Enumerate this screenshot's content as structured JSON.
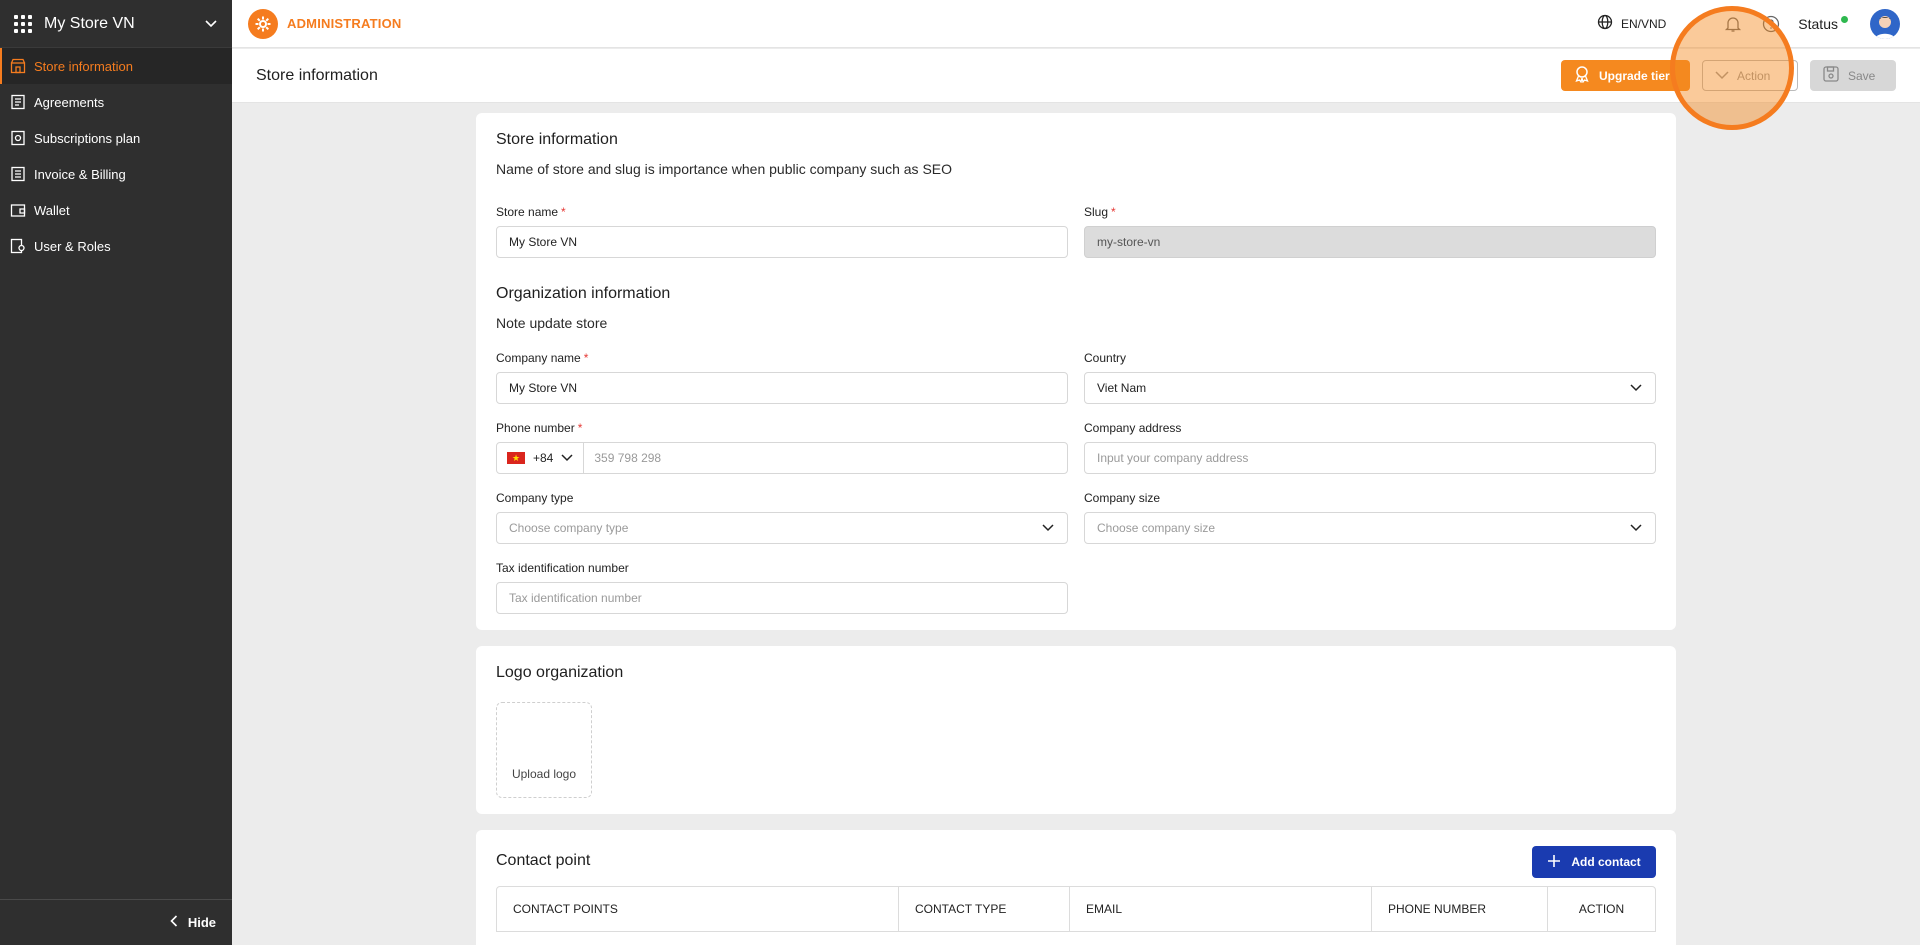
{
  "sidebar": {
    "store_name": "My Store VN",
    "items": [
      {
        "label": "Store information",
        "icon": "store-icon",
        "active": true
      },
      {
        "label": "Agreements",
        "icon": "document-icon",
        "active": false
      },
      {
        "label": "Subscriptions plan",
        "icon": "subscription-icon",
        "active": false
      },
      {
        "label": "Invoice & Billing",
        "icon": "invoice-icon",
        "active": false
      },
      {
        "label": "Wallet",
        "icon": "wallet-icon",
        "active": false
      },
      {
        "label": "User & Roles",
        "icon": "users-icon",
        "active": false
      }
    ],
    "hide_label": "Hide"
  },
  "topbar": {
    "app_label": "ADMINISTRATION",
    "lang": "EN/VND",
    "status_label": "Status"
  },
  "header": {
    "title": "Store information",
    "upgrade_label": "Upgrade tier",
    "action_label": "Action",
    "save_label": "Save"
  },
  "store_info": {
    "title": "Store information",
    "subtitle": "Name of store and slug is importance when public company such as SEO",
    "store_name_label": "Store name",
    "store_name_value": "My Store VN",
    "slug_label": "Slug",
    "slug_value": "my-store-vn"
  },
  "org_info": {
    "title": "Organization information",
    "subtitle": "Note update store",
    "company_name_label": "Company name",
    "company_name_value": "My Store VN",
    "country_label": "Country",
    "country_value": "Viet Nam",
    "phone_label": "Phone number",
    "phone_code": "+84",
    "phone_placeholder": "359 798 298",
    "address_label": "Company address",
    "address_placeholder": "Input your company address",
    "type_label": "Company type",
    "type_placeholder": "Choose company type",
    "size_label": "Company size",
    "size_placeholder": "Choose company size",
    "tax_label": "Tax identification number",
    "tax_placeholder": "Tax identification number"
  },
  "logo": {
    "title": "Logo organization",
    "upload_label": "Upload logo"
  },
  "contact": {
    "title": "Contact point",
    "add_label": "Add contact",
    "columns": [
      "CONTACT POINTS",
      "CONTACT TYPE",
      "EMAIL",
      "PHONE NUMBER",
      "ACTION"
    ]
  },
  "colors": {
    "accent": "#f57c1f",
    "sidebar_bg": "#2f2f2f",
    "primary_button": "#1a3bb0",
    "status_online": "#2eb84f"
  }
}
